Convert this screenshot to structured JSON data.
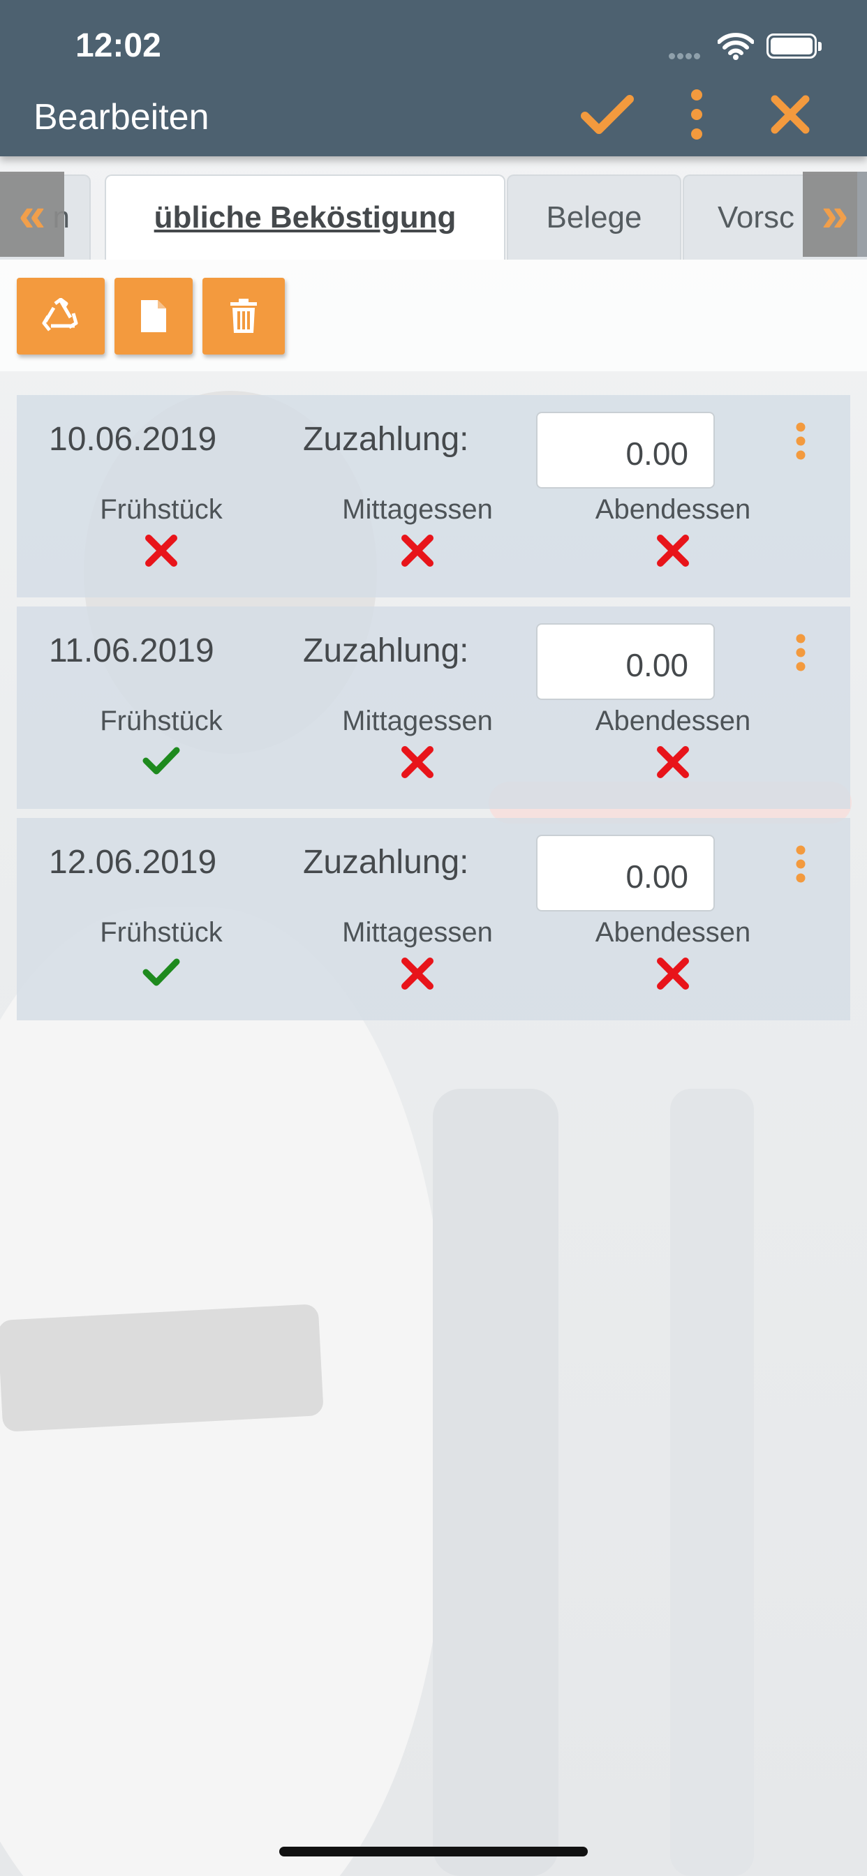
{
  "status_bar": {
    "time": "12:02"
  },
  "header": {
    "title": "Bearbeiten",
    "icons": [
      "check-icon",
      "more-vertical-icon",
      "close-icon"
    ]
  },
  "tabs": [
    {
      "label": "n"
    },
    {
      "label": "übliche Beköstigung",
      "active": true
    },
    {
      "label": "Belege"
    },
    {
      "label": "Vorsc"
    }
  ],
  "tab_scroll": {
    "left": "«",
    "right": "»"
  },
  "actions": [
    "recycle-icon",
    "document-icon",
    "trash-icon"
  ],
  "days": [
    {
      "date": "10.06.2019",
      "zuzahlung_label": "Zuzahlung:",
      "zuzahlung_value": "0.00",
      "meals": [
        {
          "label": "Frühstück",
          "status": "no"
        },
        {
          "label": "Mittagessen",
          "status": "no"
        },
        {
          "label": "Abendessen",
          "status": "no"
        }
      ]
    },
    {
      "date": "11.06.2019",
      "zuzahlung_label": "Zuzahlung:",
      "zuzahlung_value": "0.00",
      "meals": [
        {
          "label": "Frühstück",
          "status": "yes"
        },
        {
          "label": "Mittagessen",
          "status": "no"
        },
        {
          "label": "Abendessen",
          "status": "no"
        }
      ]
    },
    {
      "date": "12.06.2019",
      "zuzahlung_label": "Zuzahlung:",
      "zuzahlung_value": "0.00",
      "meals": [
        {
          "label": "Frühstück",
          "status": "yes"
        },
        {
          "label": "Mittagessen",
          "status": "no"
        },
        {
          "label": "Abendessen",
          "status": "no"
        }
      ]
    }
  ],
  "colors": {
    "header_bg": "#4d6170",
    "accent": "#f39a3e",
    "yes": "#1e8a1e",
    "no": "#e8141a"
  }
}
